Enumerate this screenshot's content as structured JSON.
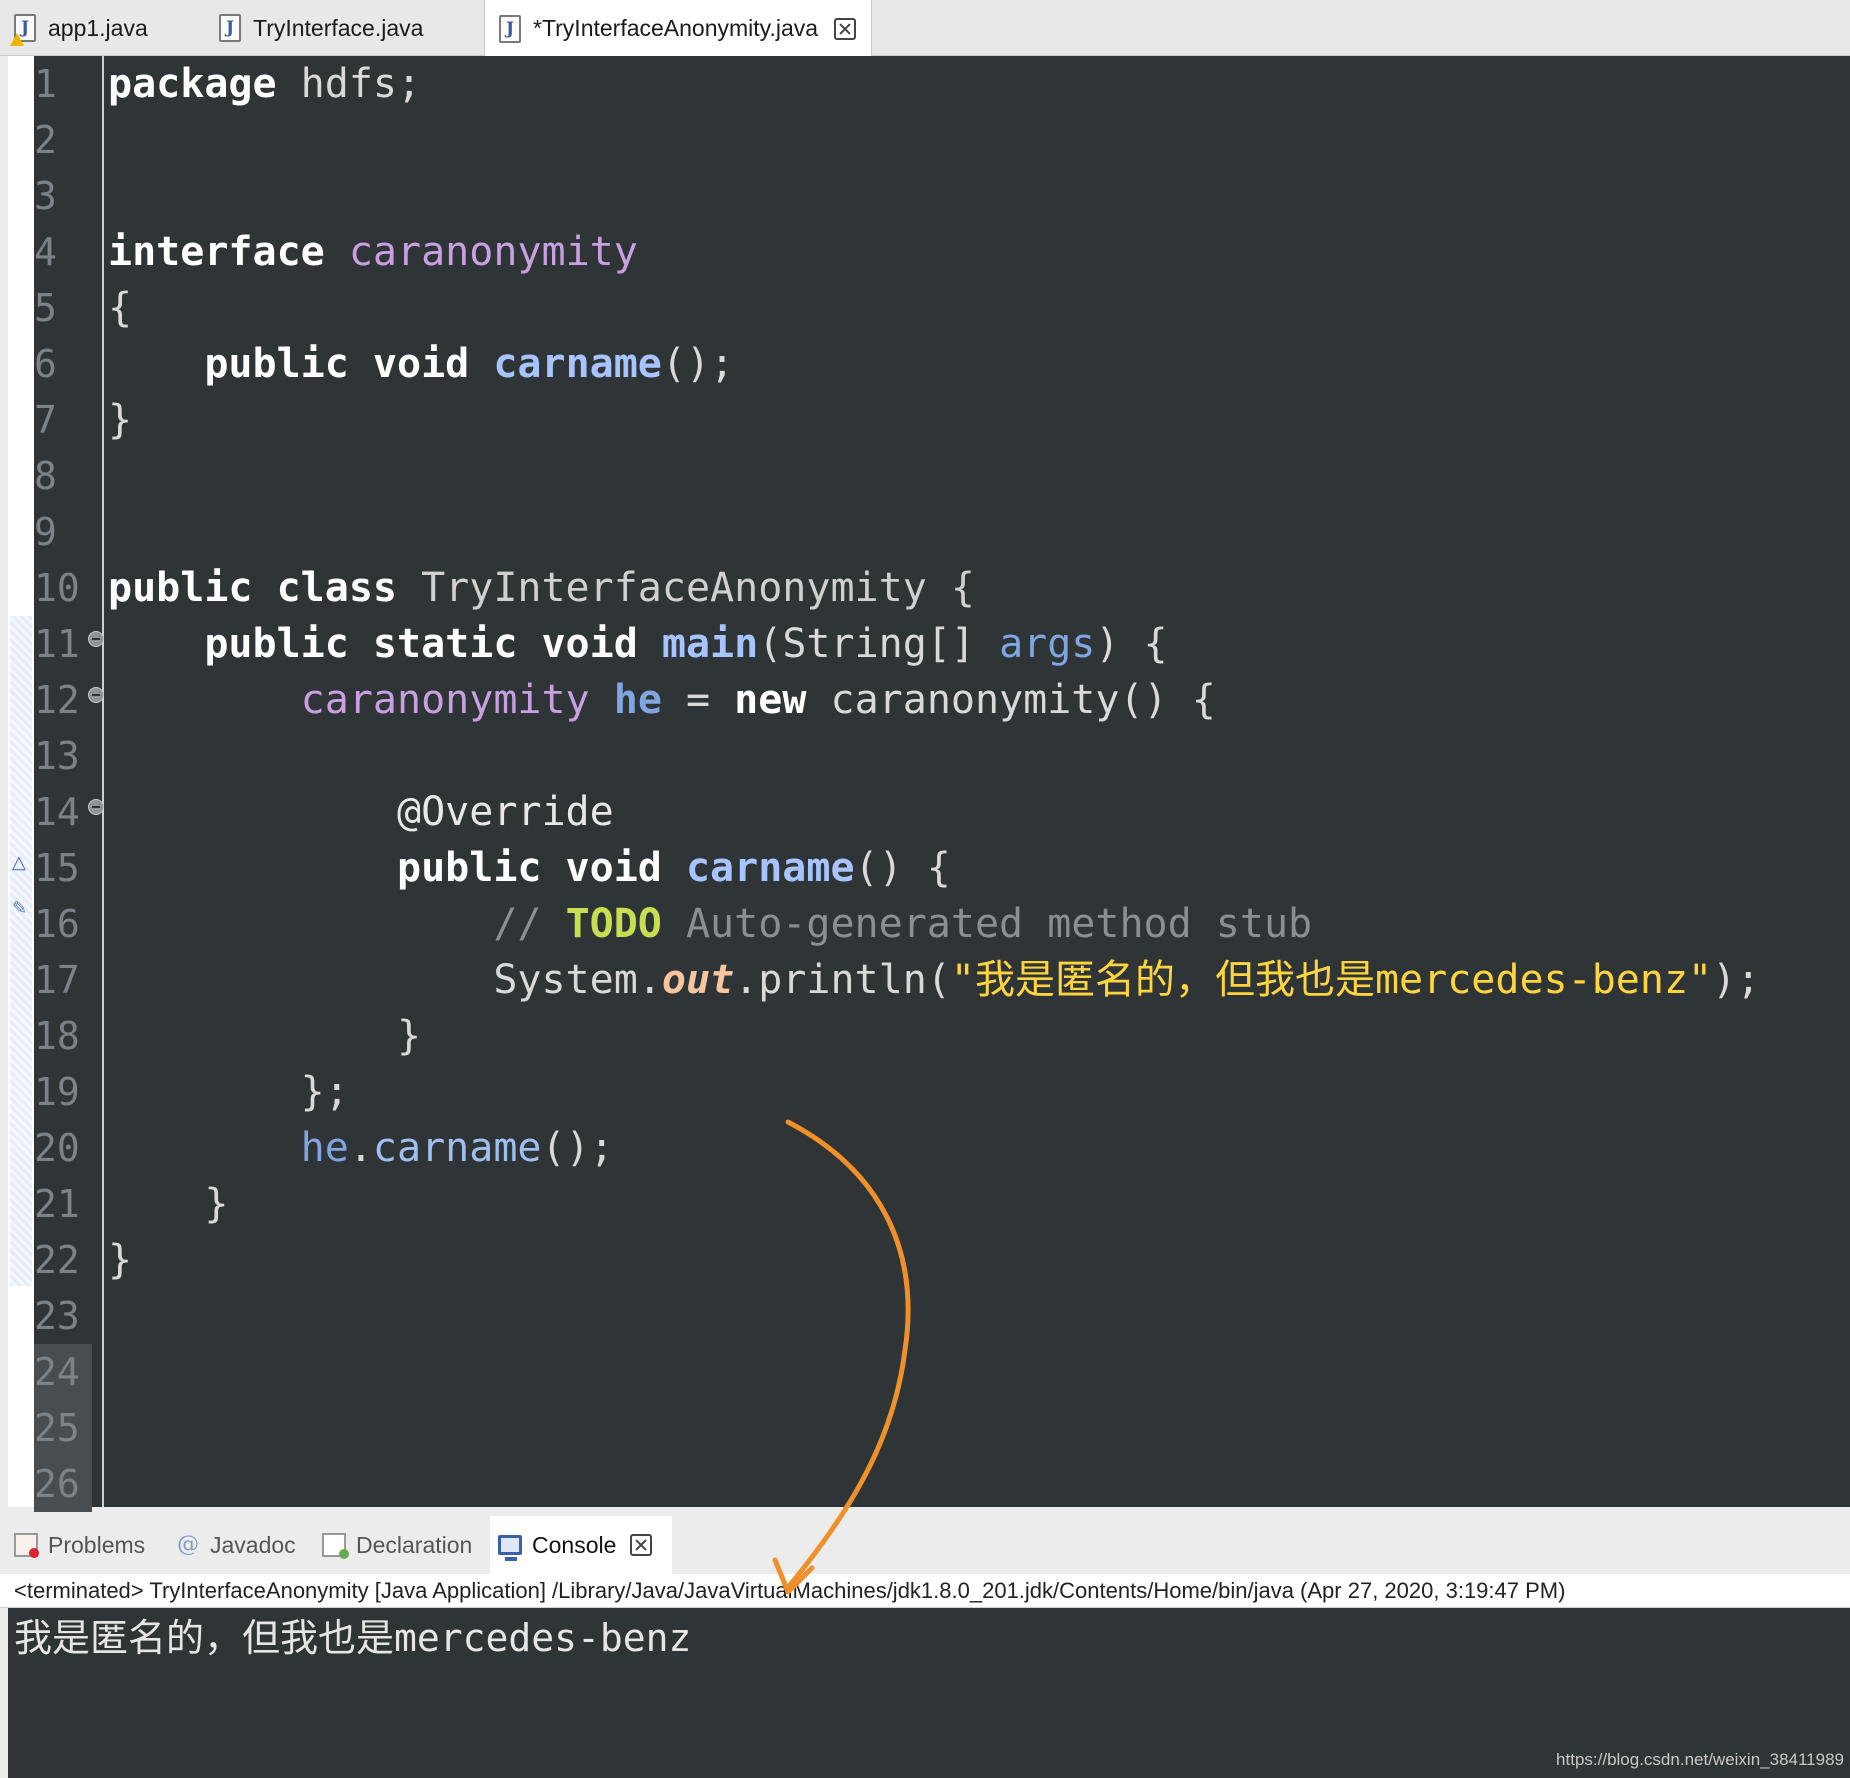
{
  "editor_tabs": [
    {
      "label": "app1.java",
      "icon": "java-file-warning-icon"
    },
    {
      "label": "TryInterface.java",
      "icon": "java-file-icon"
    },
    {
      "label": "*TryInterfaceAnonymity.java",
      "icon": "java-file-icon",
      "active": true
    }
  ],
  "editor": {
    "line_numbers": [
      "1",
      "2",
      "3",
      "4",
      "5",
      "6",
      "7",
      "8",
      "9",
      "10",
      "11",
      "12",
      "13",
      "14",
      "15",
      "16",
      "17",
      "18",
      "19",
      "20",
      "21",
      "22",
      "23",
      "24",
      "25",
      "26"
    ],
    "code": {
      "l1_kw": "package",
      "l1_rest": " hdfs;",
      "l4_kw": "interface",
      "l4_type": " caranonymity",
      "l5": "{",
      "l6_indent": "    ",
      "l6_kw": "public void",
      "l6_method": " carname",
      "l6_rest": "();",
      "l7": "}",
      "l10_kw": "public class",
      "l10_cls": " TryInterfaceAnonymity {",
      "l11_indent": "    ",
      "l11_kw": "public static void",
      "l11_method": " main",
      "l11_p1": "(String[] ",
      "l11_args": "args",
      "l11_p2": ") {",
      "l12_indent": "        ",
      "l12_type": "caranonymity",
      "l12_sp": " ",
      "l12_var": "he",
      "l12_eq": " = ",
      "l12_kw": "new",
      "l12_rest": " caranonymity() {",
      "l14_indent": "            ",
      "l14_annot": "@Override",
      "l15_indent": "            ",
      "l15_kw": "public void",
      "l15_method": " carname",
      "l15_rest": "() {",
      "l16_indent": "                ",
      "l16_c1": "// ",
      "l16_todo": "TODO",
      "l16_c2": " Auto-generated method stub",
      "l17_indent": "                ",
      "l17_sys": "System.",
      "l17_out": "out",
      "l17_p": ".println(",
      "l17_str": "\"我是匿名的，但我也是mercedes-benz\"",
      "l17_end": ");",
      "l18_indent": "            ",
      "l18": "}",
      "l19_indent": "        ",
      "l19": "};",
      "l20_indent": "        ",
      "l20_var": "he",
      "l20_dot": ".",
      "l20_call": "carname",
      "l20_rest": "();",
      "l21_indent": "    ",
      "l21": "}",
      "l22": "}"
    }
  },
  "panel_tabs": [
    {
      "label": "Problems",
      "icon": "problems-icon"
    },
    {
      "label": "Javadoc",
      "icon": "at-icon"
    },
    {
      "label": "Declaration",
      "icon": "declaration-icon"
    },
    {
      "label": "Console",
      "icon": "console-icon",
      "active": true
    }
  ],
  "console": {
    "status": "<terminated> TryInterfaceAnonymity [Java Application] /Library/Java/JavaVirtualMachines/jdk1.8.0_201.jdk/Contents/Home/bin/java (Apr 27, 2020, 3:19:47 PM)",
    "output": "我是匿名的，但我也是mercedes-benz"
  },
  "watermark": "https://blog.csdn.net/weixin_38411989",
  "colors": {
    "editor_bg": "#2f3437",
    "keyword": "#ffffff",
    "type": "#c8a0e0",
    "string": "#ffd53e",
    "todo": "#c6de4f",
    "annotation_arrow": "#f0902a"
  }
}
